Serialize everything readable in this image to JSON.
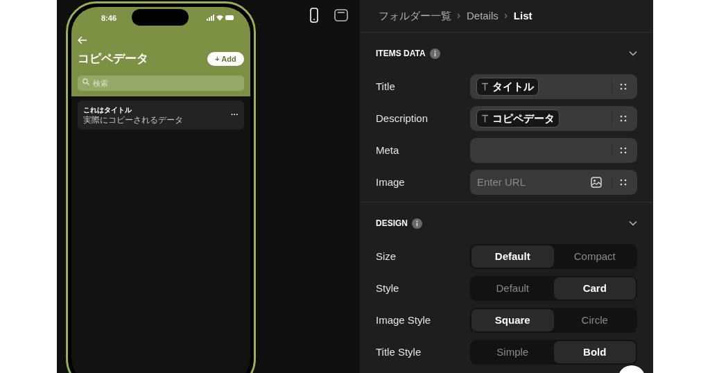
{
  "phone": {
    "status_time": "8:46",
    "title": "コピペデータ",
    "add_button": "+ Add",
    "search": {
      "placeholder": "検索"
    },
    "list_items": [
      {
        "title": "これはタイトル",
        "description": "実際にコピーされるデータ",
        "menu": "···"
      }
    ]
  },
  "preview_modes": [
    {
      "kind": "phone",
      "selected": true
    },
    {
      "kind": "tablet",
      "selected": false
    }
  ],
  "breadcrumb": [
    {
      "label": "フォルダー一覧",
      "current": false
    },
    {
      "label": "Details",
      "current": false
    },
    {
      "label": "List",
      "current": true
    }
  ],
  "sections": [
    {
      "title": "ITEMS DATA",
      "expanded": true,
      "fields": [
        {
          "label": "Title",
          "kind": "token",
          "value": "タイトル"
        },
        {
          "label": "Description",
          "kind": "token",
          "value": "コピペデータ"
        },
        {
          "label": "Meta",
          "kind": "empty"
        },
        {
          "label": "Image",
          "kind": "url",
          "placeholder": "Enter URL"
        }
      ]
    },
    {
      "title": "DESIGN",
      "expanded": true,
      "fields": [
        {
          "label": "Size",
          "kind": "segmented",
          "options": [
            {
              "label": "Default",
              "selected": true
            },
            {
              "label": "Compact",
              "selected": false
            }
          ]
        },
        {
          "label": "Style",
          "kind": "segmented",
          "options": [
            {
              "label": "Default",
              "selected": false
            },
            {
              "label": "Card",
              "selected": true
            }
          ]
        },
        {
          "label": "Image Style",
          "kind": "segmented",
          "options": [
            {
              "label": "Square",
              "selected": true
            },
            {
              "label": "Circle",
              "selected": false
            }
          ]
        },
        {
          "label": "Title Style",
          "kind": "segmented",
          "options": [
            {
              "label": "Simple",
              "selected": false
            },
            {
              "label": "Bold",
              "selected": true
            }
          ]
        }
      ]
    }
  ]
}
